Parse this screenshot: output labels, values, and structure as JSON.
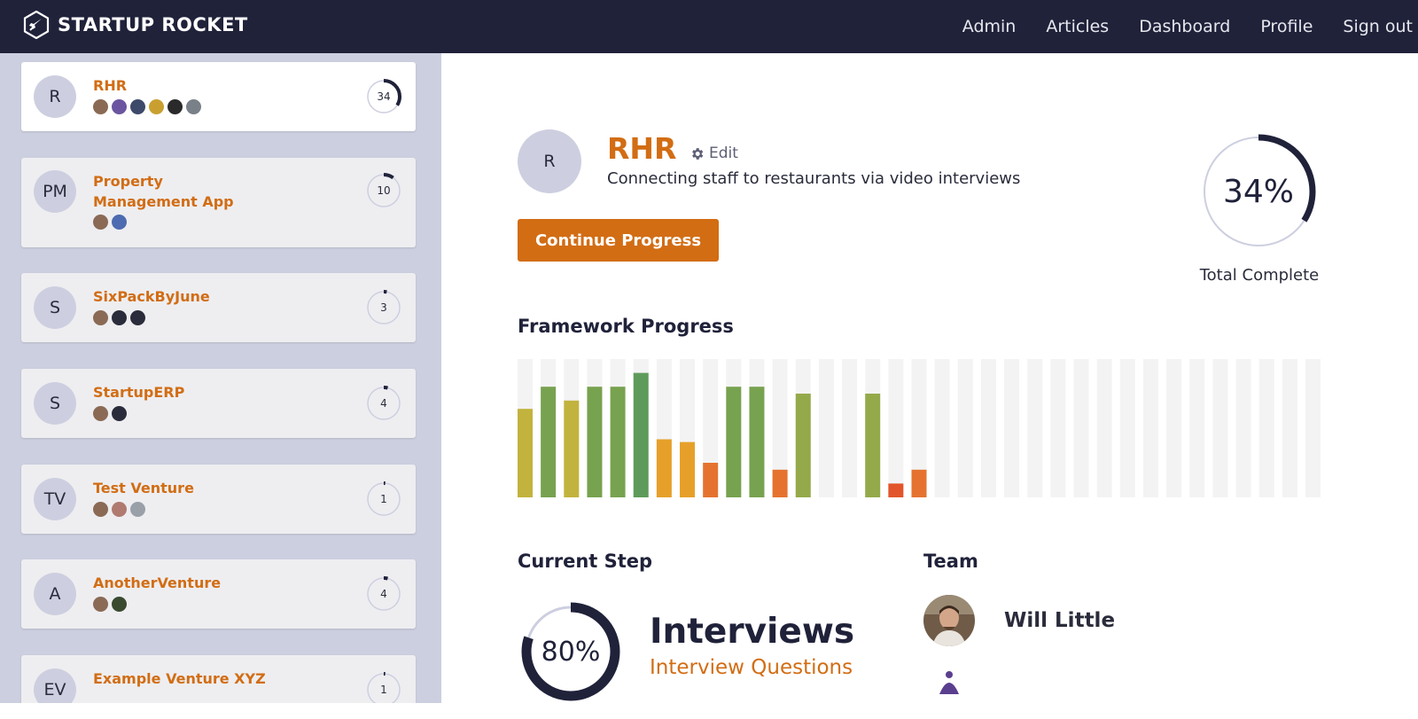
{
  "brand": {
    "name": "STARTUP ROCKET"
  },
  "nav": [
    "Admin",
    "Articles",
    "Dashboard",
    "Profile",
    "Sign out"
  ],
  "ventures": [
    {
      "initials": "R",
      "name": "RHR",
      "progress": 34,
      "active": true,
      "members": [
        "#8a6a55",
        "#6b55a0",
        "#3e4a6a",
        "#c9a030",
        "#2a2a2a",
        "#7a8088"
      ]
    },
    {
      "initials": "PM",
      "name": "Property Management App",
      "progress": 10,
      "active": false,
      "members": [
        "#8a6a55",
        "#4d6bb0"
      ]
    },
    {
      "initials": "S",
      "name": "SixPackByJune",
      "progress": 3,
      "active": false,
      "members": [
        "#8a6a55",
        "#2a2c3b",
        "#2a2c3b"
      ]
    },
    {
      "initials": "S",
      "name": "StartupERP",
      "progress": 4,
      "active": false,
      "members": [
        "#8a6a55",
        "#2a2c3b"
      ]
    },
    {
      "initials": "TV",
      "name": "Test Venture",
      "progress": 1,
      "active": false,
      "members": [
        "#8a6a55",
        "#b07a70",
        "#9aa0a8"
      ]
    },
    {
      "initials": "A",
      "name": "AnotherVenture",
      "progress": 4,
      "active": false,
      "members": [
        "#8a6a55",
        "#3a4a30"
      ]
    },
    {
      "initials": "EV",
      "name": "Example Venture XYZ",
      "progress": 1,
      "active": false,
      "members": []
    }
  ],
  "venture": {
    "initials": "R",
    "name": "RHR",
    "edit_label": "Edit",
    "tagline": "Connecting staff to restaurants via video interviews",
    "continue_label": "Continue Progress",
    "total_percent_label": "34%",
    "total_percent": 34,
    "total_label": "Total Complete"
  },
  "framework": {
    "title": "Framework Progress",
    "bars": [
      64,
      80,
      70,
      80,
      80,
      90,
      42,
      40,
      25,
      80,
      80,
      20,
      75,
      0,
      0,
      75,
      10,
      20,
      0,
      0,
      0,
      0,
      0,
      0,
      0,
      0,
      0,
      0,
      0,
      0,
      0,
      0,
      0,
      0,
      0
    ],
    "colors": {
      "high": "#5e9b5a",
      "good": "#77a24f",
      "mid": "#94aa4a",
      "yellow": "#c2b33e",
      "orange": "#e6a02a",
      "low": "#e5732f",
      "verylow": "#e2552a",
      "track": "#f3f3f4"
    }
  },
  "current_step": {
    "title": "Current Step",
    "percent_label": "80%",
    "percent": 80,
    "name": "Interviews",
    "subtitle": "Interview Questions"
  },
  "team": {
    "title": "Team",
    "members": [
      {
        "name": "Will Little",
        "photo": "photo-will-little"
      },
      {
        "name": "",
        "photo": "photo-member-2"
      }
    ]
  },
  "colors": {
    "accent": "#d26d14",
    "navy": "#20223a",
    "sidebar": "#cccfdf"
  }
}
